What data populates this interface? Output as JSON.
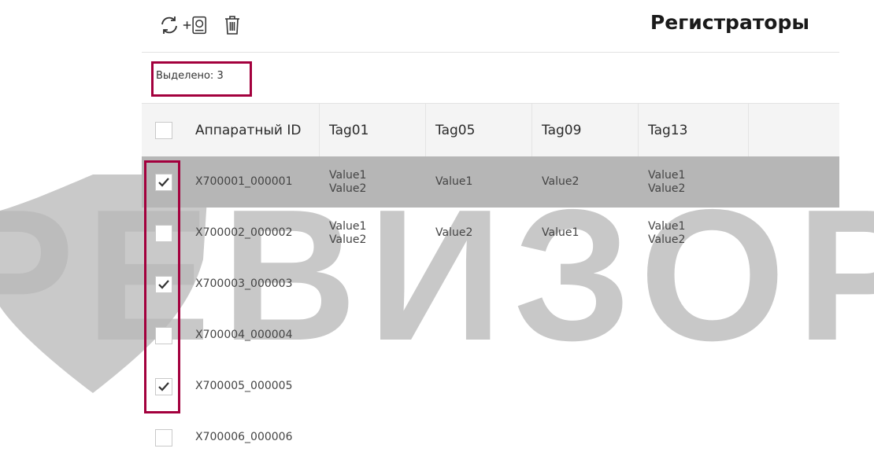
{
  "watermark": {
    "text": "РЕВИЗОР",
    "color": "#b9b9b9"
  },
  "toolbar": {
    "refresh_icon": "refresh-icon",
    "add_icon": "add-device-icon",
    "delete_icon": "trash-icon"
  },
  "page": {
    "title": "Регистраторы",
    "accent": "#a3003d"
  },
  "selection": {
    "text": "Выделено: 3"
  },
  "table": {
    "columns": [
      "Аппаратный ID",
      "Tag01",
      "Tag05",
      "Tag09",
      "Tag13"
    ],
    "rows": [
      {
        "checked": true,
        "id": "X700001_000001",
        "tag01": [
          "Value1",
          "Value2"
        ],
        "tag05": "Value1",
        "tag09": "Value2",
        "tag13": [
          "Value1",
          "Value2"
        ]
      },
      {
        "checked": false,
        "id": "X700002_000002",
        "tag01": [
          "Value1",
          "Value2"
        ],
        "tag05": "Value2",
        "tag09": "Value1",
        "tag13": [
          "Value1",
          "Value2"
        ]
      },
      {
        "checked": true,
        "id": "X700003_000003",
        "tag01": [
          "",
          ""
        ],
        "tag05": "",
        "tag09": "",
        "tag13": [
          "",
          ""
        ]
      },
      {
        "checked": false,
        "id": "X700004_000004",
        "tag01": [
          "",
          ""
        ],
        "tag05": "",
        "tag09": "",
        "tag13": [
          "",
          ""
        ]
      },
      {
        "checked": true,
        "id": "X700005_000005",
        "tag01": [
          "",
          ""
        ],
        "tag05": "",
        "tag09": "",
        "tag13": [
          "",
          ""
        ]
      },
      {
        "checked": false,
        "id": "X700006_000006",
        "tag01": [
          "",
          ""
        ],
        "tag05": "",
        "tag09": "",
        "tag13": [
          "",
          ""
        ]
      }
    ]
  }
}
